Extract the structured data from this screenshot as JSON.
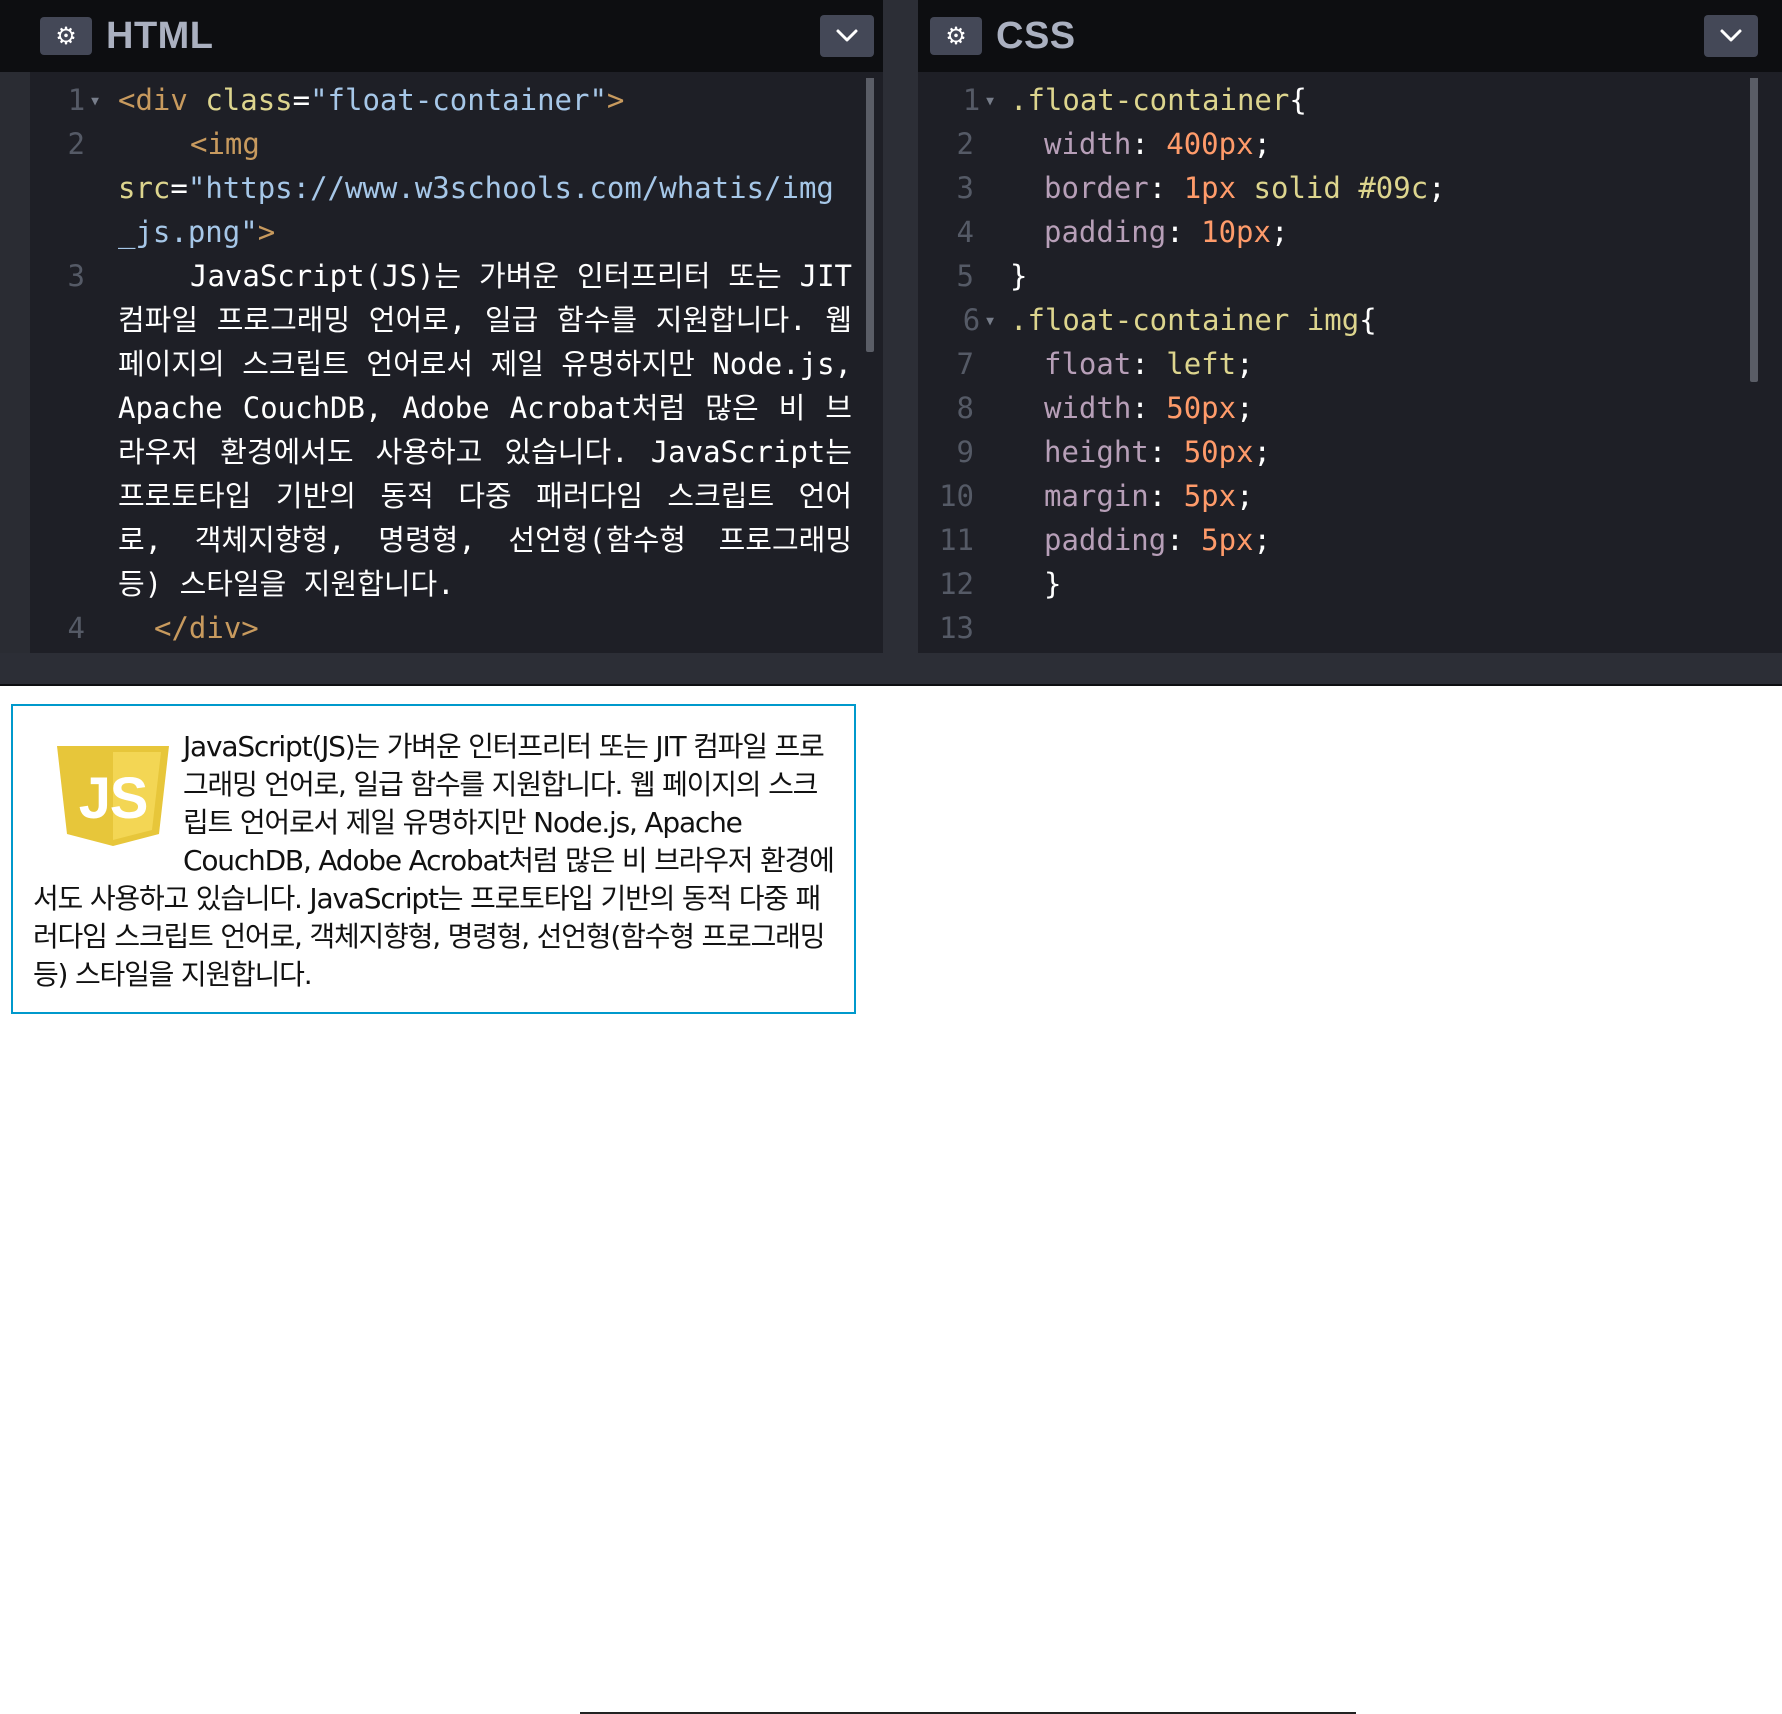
{
  "html_pane": {
    "title": "HTML",
    "settings_icon": "gear-icon",
    "collapse_icon": "chevron-down-icon",
    "line_numbers": [
      "1",
      "2",
      "3",
      "4"
    ],
    "line1": {
      "open": "<div",
      "attr": "class",
      "eq": "=",
      "value": "\"float-container\"",
      "close": ">"
    },
    "line2": {
      "open": "<img",
      "attr": "src",
      "eq": "=",
      "value_a": "\"https://www.w3schools.com/whatis/img",
      "value_b": "_js.png\"",
      "close": ">"
    },
    "line3_text": "JavaScript(JS)는 가벼운 인터프리터 또는 JIT 컴파일 프로그래밍 언어로, 일급 함수를 지원합니다. 웹 페이지의 스크립트 언어로서 제일 유명하지만 Node.js, Apache CouchDB, Adobe Acrobat처럼 많은 비 브라우저 환경에서도 사용하고 있습니다. JavaScript는 프로토타입 기반의 동적 다중 패러다임 스크립트 언어로, 객체지향형, 명령형, 선언형(함수형 프로그래밍 등) 스타일을 지원합니다.",
    "line4_close": "</div>"
  },
  "css_pane": {
    "title": "CSS",
    "settings_icon": "gear-icon",
    "collapse_icon": "chevron-down-icon",
    "line_numbers": [
      "1",
      "2",
      "3",
      "4",
      "5",
      "6",
      "7",
      "8",
      "9",
      "10",
      "11",
      "12",
      "13"
    ],
    "rules": [
      {
        "selector": ".float-container",
        "open": "{"
      },
      {
        "prop": "width",
        "value": "400px"
      },
      {
        "prop": "border",
        "value_num": "1px",
        "value_kw": "solid",
        "value_hex": "#09c"
      },
      {
        "prop": "padding",
        "value": "10px"
      },
      {
        "close": "}"
      },
      {
        "selector": ".float-container img",
        "open": "{"
      },
      {
        "prop": "float",
        "value": "left"
      },
      {
        "prop": "width",
        "value": "50px"
      },
      {
        "prop": "height",
        "value": "50px"
      },
      {
        "prop": "margin",
        "value": "5px"
      },
      {
        "prop": "padding",
        "value": "5px"
      },
      {
        "close": "}"
      }
    ]
  },
  "preview": {
    "logo_label": "JS",
    "text": "JavaScript(JS)는 가벼운 인터프리터 또는 JIT 컴파일 프로그래밍 언어로, 일급 함수를 지원합니다. 웹 페이지의 스크립트 언어로서 제일 유명하지만 Node.js, Apache CouchDB, Adobe Acrobat처럼 많은 비 브라우저 환경에서도 사용하고 있습니다. JavaScript는 프로토타입 기반의 동적 다중 패러다임 스크립트 언어로, 객체지향형, 명령형, 선언형(함수형 프로그래밍 등) 스타일을 지원합니다."
  },
  "colors": {
    "editor_bg": "#1e1f26",
    "header_bg": "#0d0e11",
    "button_bg": "#444857",
    "border_accent": "#0099cc",
    "js_yellow": "#f0d553"
  }
}
